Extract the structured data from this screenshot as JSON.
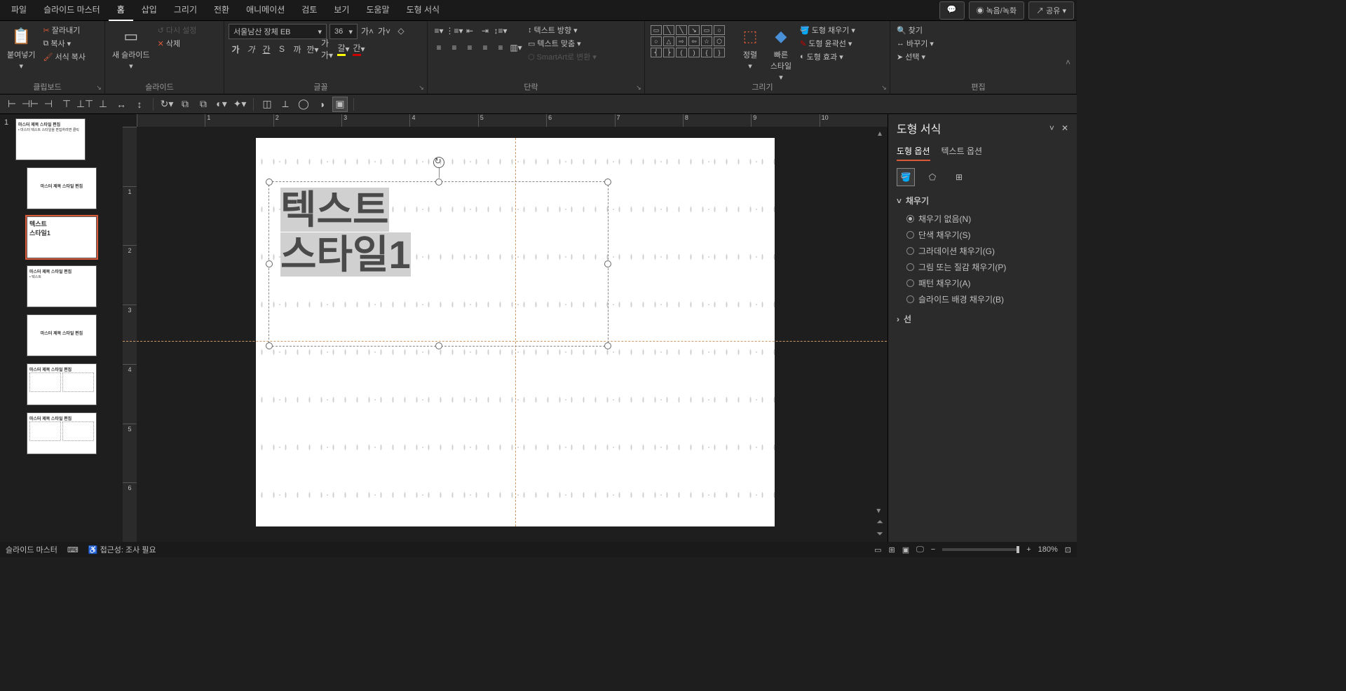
{
  "menu": {
    "file": "파일",
    "slidemaster": "슬라이드 마스터",
    "home": "홈",
    "insert": "삽입",
    "draw": "그리기",
    "transition": "전환",
    "animation": "애니메이션",
    "review": "검토",
    "view": "보기",
    "help": "도움말",
    "shapeformat": "도형 서식"
  },
  "titlebar": {
    "record": "녹음/녹화",
    "share": "공유"
  },
  "ribbon": {
    "clipboard": {
      "paste": "붙여넣기",
      "cut": "잘라내기",
      "copy": "복사",
      "format": "서식 복사",
      "label": "클립보드"
    },
    "slides": {
      "new": "새 슬라이드",
      "reset": "다시 설정",
      "delete": "삭제",
      "label": "슬라이드"
    },
    "font": {
      "name": "서울남산 장체 EB",
      "size": "36",
      "label": "글꼴"
    },
    "paragraph": {
      "textdir": "텍스트 방향",
      "textalign": "텍스트 맞춤",
      "smartart": "SmartArt로 변환",
      "label": "단락"
    },
    "drawing": {
      "arrange": "정렬",
      "quickstyle": "빠른\n스타일",
      "fill": "도형 채우기",
      "outline": "도형 윤곽선",
      "effects": "도형 효과",
      "label": "그리기"
    },
    "editing": {
      "find": "찾기",
      "replace": "바꾸기",
      "select": "선택",
      "label": "편집"
    }
  },
  "textbox": {
    "line1": "텍스트",
    "line2": "스타일1"
  },
  "pane": {
    "title": "도형 서식",
    "tab1": "도형 옵션",
    "tab2": "텍스트 옵션",
    "fill": "채우기",
    "line": "선",
    "nofill": "채우기 없음(N)",
    "solid": "단색 채우기(S)",
    "gradient": "그라데이션 채우기(G)",
    "picture": "그림 또는 질감 채우기(P)",
    "pattern": "패턴 채우기(A)",
    "slidebg": "슬라이드 배경 채우기(B)"
  },
  "status": {
    "mode": "슬라이드 마스터",
    "access": "접근성: 조사 필요",
    "zoom": "180%"
  },
  "ruler_h": [
    "",
    "1",
    "2",
    "3",
    "4",
    "5",
    "6",
    "7",
    "8",
    "9",
    "10"
  ],
  "ruler_v": [
    "",
    "1",
    "2",
    "3",
    "4",
    "5",
    "6"
  ]
}
